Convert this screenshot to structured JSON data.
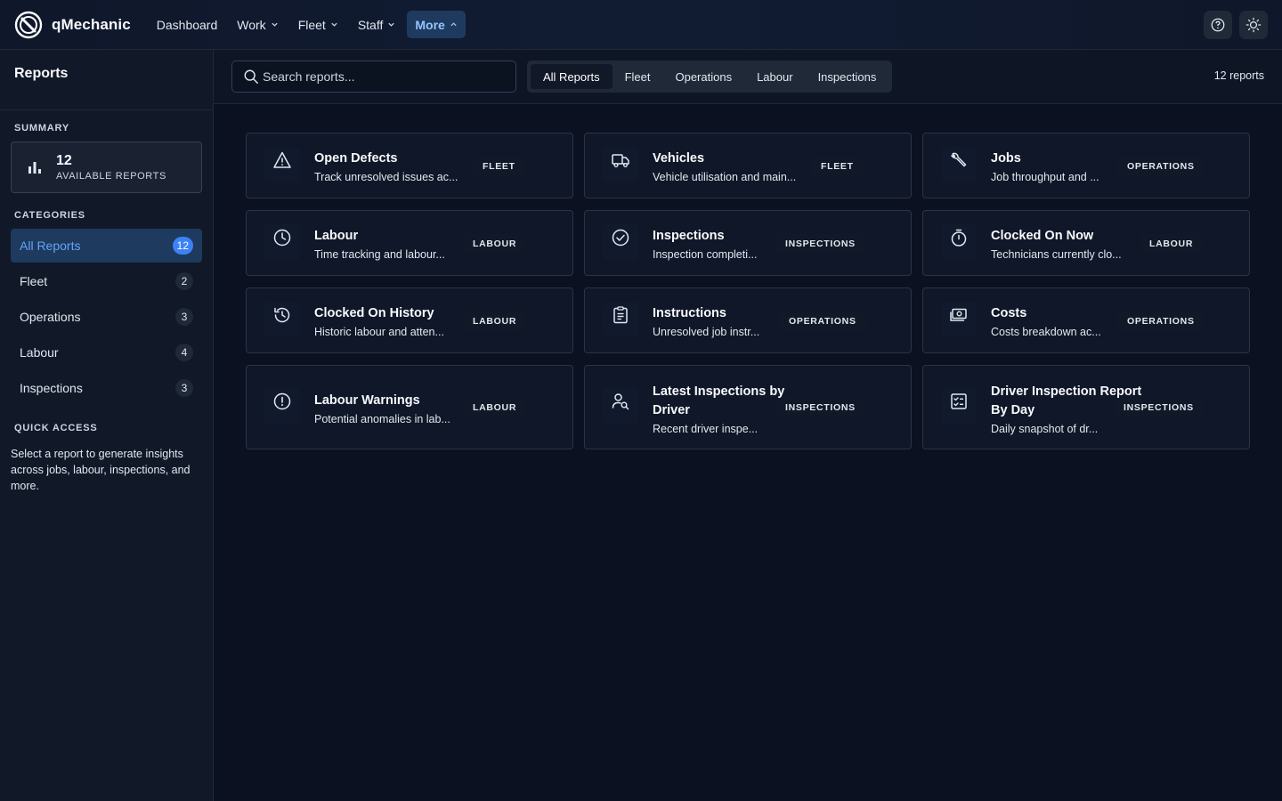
{
  "app": {
    "name": "qMechanic"
  },
  "nav": {
    "items": [
      {
        "label": "Dashboard",
        "has_menu": false,
        "active": false
      },
      {
        "label": "Work",
        "has_menu": true,
        "active": false
      },
      {
        "label": "Fleet",
        "has_menu": true,
        "active": false
      },
      {
        "label": "Staff",
        "has_menu": true,
        "active": false
      },
      {
        "label": "More",
        "has_menu": true,
        "active": true
      }
    ],
    "help_icon": "help-circle-icon",
    "theme_icon": "sun-icon"
  },
  "sidebar": {
    "title": "Reports",
    "summary_label": "SUMMARY",
    "summary": {
      "count": "12",
      "label": "AVAILABLE REPORTS",
      "icon": "bar-chart-icon"
    },
    "categories_label": "CATEGORIES",
    "categories": [
      {
        "label": "All Reports",
        "count": "12",
        "active": true
      },
      {
        "label": "Fleet",
        "count": "2",
        "active": false
      },
      {
        "label": "Operations",
        "count": "3",
        "active": false
      },
      {
        "label": "Labour",
        "count": "4",
        "active": false
      },
      {
        "label": "Inspections",
        "count": "3",
        "active": false
      }
    ],
    "quick_access_label": "QUICK ACCESS",
    "quick_access_text": "Select a report to generate insights across jobs, labour, inspections, and more."
  },
  "toolbar": {
    "search_placeholder": "Search reports...",
    "tabs": [
      "All Reports",
      "Fleet",
      "Operations",
      "Labour",
      "Inspections"
    ],
    "active_tab": "All Reports",
    "count_text": "12 reports"
  },
  "reports": [
    {
      "title": "Open Defects",
      "description": "Track unresolved issues ac...",
      "badge": "FLEET",
      "icon": "warning-triangle-icon"
    },
    {
      "title": "Vehicles",
      "description": "Vehicle utilisation and main...",
      "badge": "FLEET",
      "icon": "truck-icon"
    },
    {
      "title": "Jobs",
      "description": "Job throughput and ...",
      "badge": "OPERATIONS",
      "icon": "wrench-icon"
    },
    {
      "title": "Labour",
      "description": "Time tracking and labour...",
      "badge": "LABOUR",
      "icon": "clock-icon"
    },
    {
      "title": "Inspections",
      "description": "Inspection completi...",
      "badge": "INSPECTIONS",
      "icon": "check-circle-icon"
    },
    {
      "title": "Clocked On Now",
      "description": "Technicians currently clo...",
      "badge": "LABOUR",
      "icon": "stopwatch-icon"
    },
    {
      "title": "Clocked On History",
      "description": "Historic labour and atten...",
      "badge": "LABOUR",
      "icon": "history-icon"
    },
    {
      "title": "Instructions",
      "description": "Unresolved job instr...",
      "badge": "OPERATIONS",
      "icon": "clipboard-icon"
    },
    {
      "title": "Costs",
      "description": "Costs breakdown ac...",
      "badge": "OPERATIONS",
      "icon": "money-icon"
    },
    {
      "title": "Labour Warnings",
      "description": "Potential anomalies in lab...",
      "badge": "LABOUR",
      "icon": "alert-circle-icon"
    },
    {
      "title": "Latest Inspections by Driver",
      "description": "Recent driver inspe...",
      "badge": "INSPECTIONS",
      "icon": "user-search-icon"
    },
    {
      "title": "Driver Inspection Report By Day",
      "description": "Daily snapshot of dr...",
      "badge": "INSPECTIONS",
      "icon": "checklist-icon"
    }
  ]
}
